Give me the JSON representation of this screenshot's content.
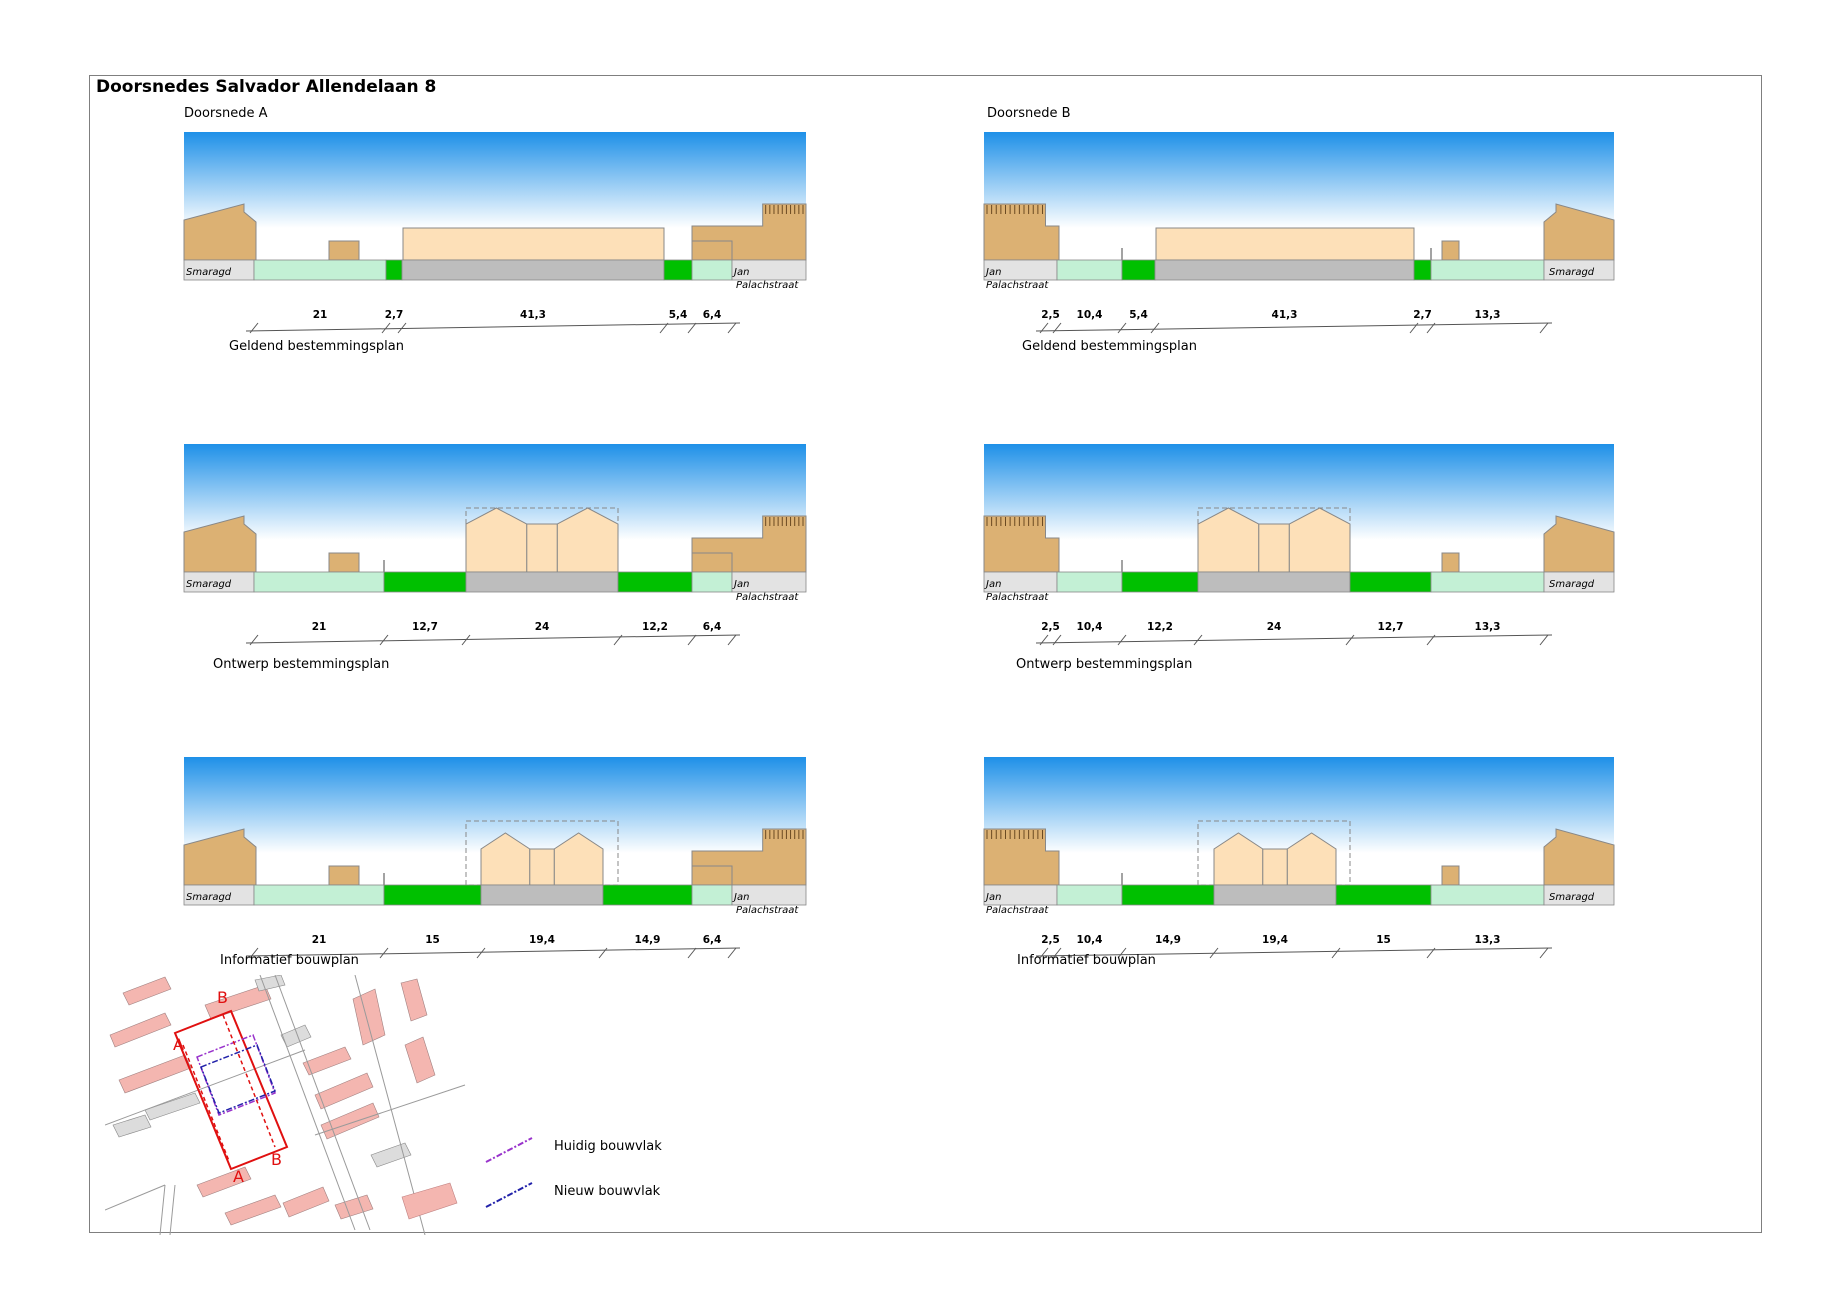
{
  "title": "Doorsnedes Salvador Allendelaan 8",
  "columns": [
    {
      "title": "Doorsnede A",
      "left_label": "Smaragd",
      "right_label": [
        "Jan",
        "Palachstraat"
      ],
      "rows": [
        {
          "caption": "Geldend bestemmingsplan",
          "dims": [
            "21",
            "2,7",
            "41,3",
            "5,4",
            "6,4"
          ]
        },
        {
          "caption": "Ontwerp bestemmingsplan",
          "dims": [
            "21",
            "12,7",
            "24",
            "12,2",
            "6,4"
          ]
        },
        {
          "caption": "Informatief bouwplan",
          "dims": [
            "21",
            "15",
            "19,4",
            "14,9",
            "6,4"
          ]
        }
      ]
    },
    {
      "title": "Doorsnede B",
      "left_label": [
        "Jan",
        "Palachstraat"
      ],
      "right_label": "Smaragd",
      "rows": [
        {
          "caption": "Geldend bestemmingsplan",
          "dims": [
            "2,5",
            "10,4",
            "5,4",
            "41,3",
            "2,7",
            "13,3"
          ]
        },
        {
          "caption": "Ontwerp bestemmingsplan",
          "dims": [
            "2,5",
            "10,4",
            "12,2",
            "24",
            "12,7",
            "13,3"
          ]
        },
        {
          "caption": "Informatief bouwplan",
          "dims": [
            "2,5",
            "10,4",
            "14,9",
            "19,4",
            "15",
            "13,3"
          ]
        }
      ]
    }
  ],
  "map": {
    "marker_a": "A",
    "marker_b": "B"
  },
  "legend": [
    {
      "label": "Huidig bouwvlak",
      "color": "#9933cc"
    },
    {
      "label": "Nieuw bouwvlak",
      "color": "#2222aa"
    }
  ],
  "colors": {
    "sky_top": "#1e90e8",
    "house": "#dcb173",
    "building": "#fde0b8",
    "light_green": "#c3f0d5",
    "green": "#00c000",
    "road": "#bdbdbd",
    "street": "#e3e3e3"
  }
}
